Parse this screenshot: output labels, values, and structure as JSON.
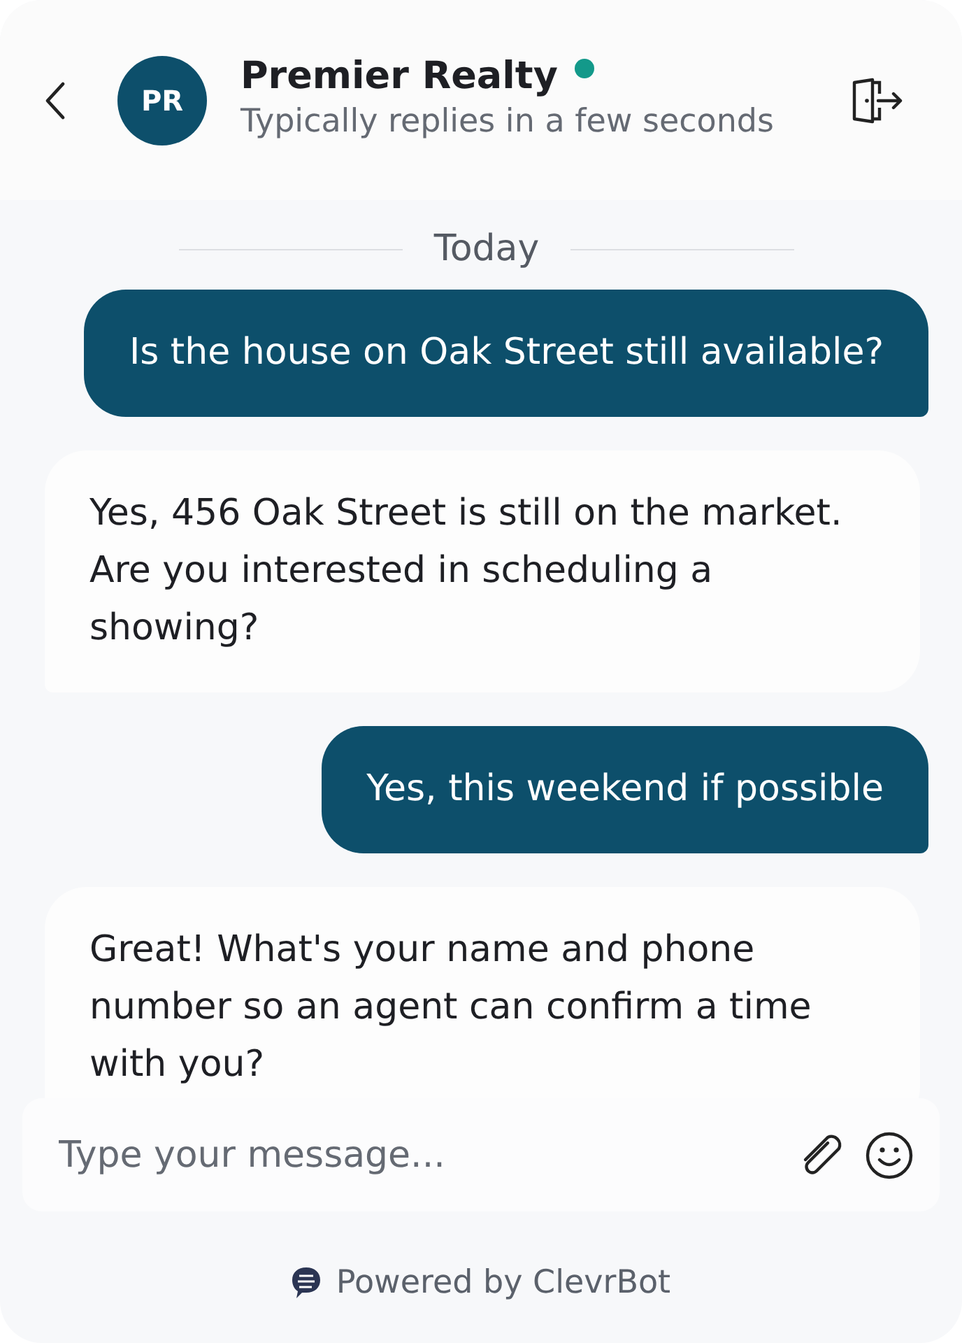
{
  "header": {
    "avatar": "PR",
    "title": "Premier Realty",
    "online": true,
    "subtitle": "Typically replies in a few seconds"
  },
  "date_divider": "Today",
  "messages": [
    {
      "kind": "user",
      "text": "Is the house on Oak Street still available?"
    },
    {
      "kind": "bot",
      "text": "Yes, 456 Oak Street is still on the market. Are you interested in scheduling a showing?"
    },
    {
      "kind": "user",
      "text": "Yes, this weekend if possible"
    },
    {
      "kind": "bot",
      "text": "Great! What's your name and phone number so an agent can confirm a time with you?"
    }
  ],
  "composer": {
    "placeholder": "Type your message..."
  },
  "footer": "Powered by ClevrBot"
}
